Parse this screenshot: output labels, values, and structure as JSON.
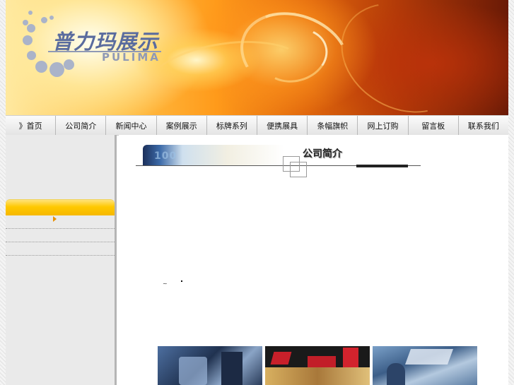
{
  "header": {
    "logo_cn": "普力玛展示",
    "logo_en": "PULIMA"
  },
  "nav": {
    "items": [
      "》首页",
      "公司简介",
      "新闻中心",
      "案例展示",
      "标牌系列",
      "便携展具",
      "条幅旗帜",
      "网上订购",
      "留言板",
      "联系我们"
    ]
  },
  "content": {
    "section_title": "公司简介",
    "title_strip_text": "100"
  },
  "colors": {
    "accent": "#ffc800",
    "logo": "#5a6c9e",
    "sidebar": "#eaeaea"
  }
}
